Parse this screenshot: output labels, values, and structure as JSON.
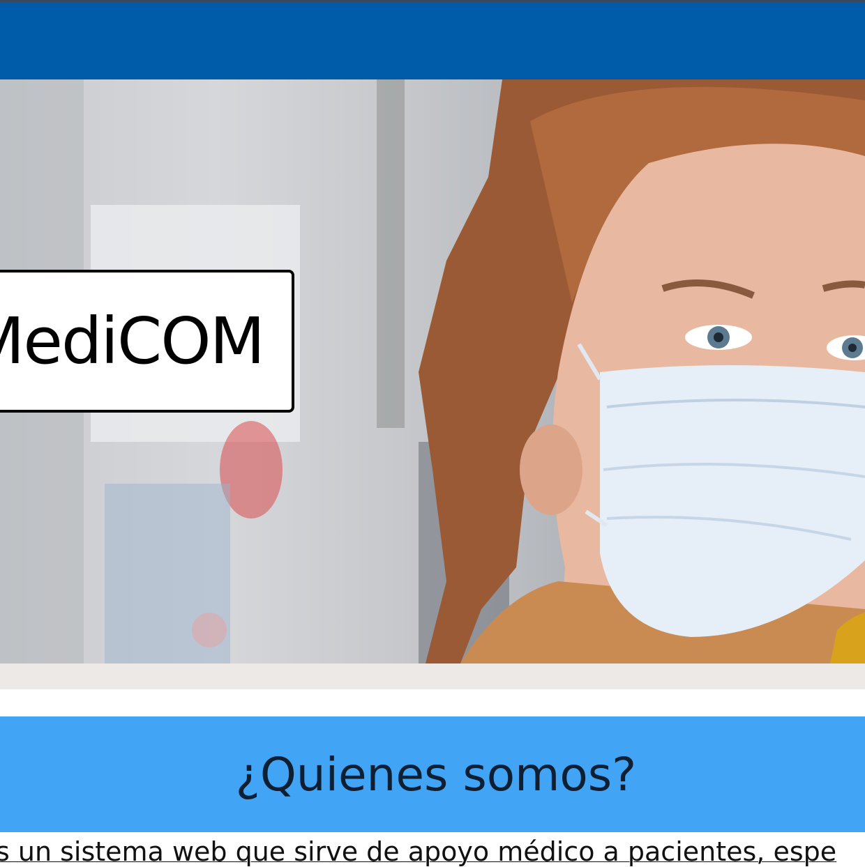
{
  "brand": {
    "name": "MediCOM"
  },
  "hero": {
    "photo_icon": "masked-woman-photo"
  },
  "about": {
    "title": "¿Quienes somos?",
    "text": "s un sistema web que sirve de apoyo médico a pacientes, espe"
  },
  "colors": {
    "navbar": "#005ba8",
    "about_banner": "#42a4f5",
    "strip": "#ece9e7"
  }
}
